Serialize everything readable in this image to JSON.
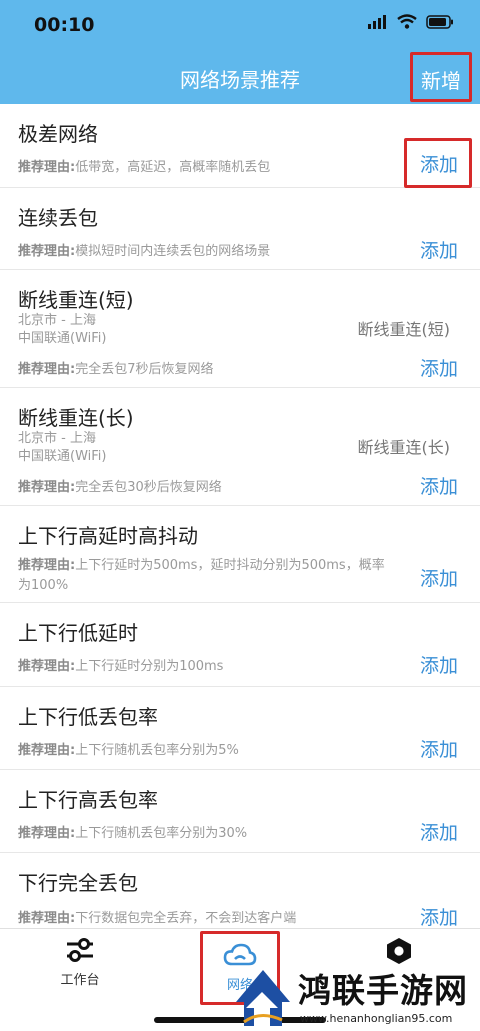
{
  "status": {
    "time": "00:10"
  },
  "nav": {
    "title": "网络场景推荐",
    "action": "新增"
  },
  "reason_label": "推荐理由:",
  "add_label": "添加",
  "rows": [
    {
      "title": "极差网络",
      "reason": "低带宽，高延迟，高概率随机丢包"
    },
    {
      "title": "连续丢包",
      "reason": "模拟短时间内连续丢包的网络场景"
    },
    {
      "title": "断线重连(短)",
      "loc1": "北京市 - 上海",
      "loc2": "中国联通(WiFi)",
      "tag": "断线重连(短)",
      "reason": "完全丢包7秒后恢复网络"
    },
    {
      "title": "断线重连(长)",
      "loc1": "北京市 - 上海",
      "loc2": "中国联通(WiFi)",
      "tag": "断线重连(长)",
      "reason": "完全丢包30秒后恢复网络"
    },
    {
      "title": "上下行高延时高抖动",
      "reason": "上下行延时为500ms，延时抖动分别为500ms，概率为100%"
    },
    {
      "title": "上下行低延时",
      "reason": "上下行延时分别为100ms"
    },
    {
      "title": "上下行低丢包率",
      "reason": "上下行随机丢包率分别为5%"
    },
    {
      "title": "上下行高丢包率",
      "reason": "上下行随机丢包率分别为30%"
    },
    {
      "title": "下行完全丢包",
      "reason": "下行数据包完全丢弃，不会到达客户端"
    }
  ],
  "tabs": {
    "workbench": "工作台",
    "network": "网络"
  },
  "watermark": {
    "text": "鸿联手游网",
    "url": "www.henanhonglian95.com"
  },
  "colors": {
    "header": "#5fb8ec",
    "accent": "#3a8fd6",
    "highlight": "#d62a2a"
  }
}
